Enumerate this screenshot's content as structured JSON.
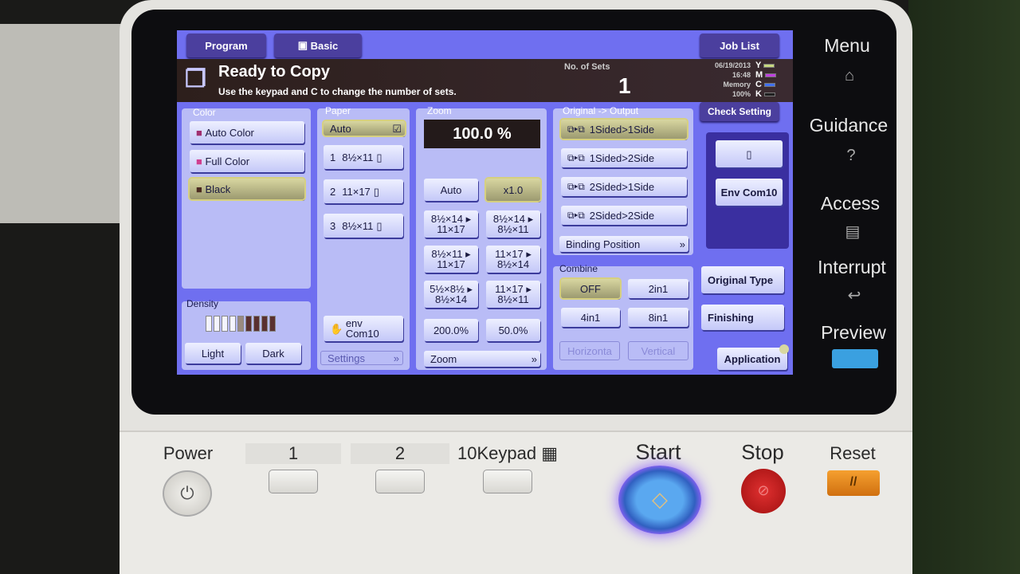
{
  "tabs": {
    "program": "Program",
    "basic": "Basic",
    "job_list": "Job List",
    "check_setting": "Check Setting"
  },
  "status": {
    "title": "Ready to Copy",
    "message": "Use the keypad and C to change the number of sets.",
    "sets_label": "No. of Sets",
    "sets_value": "1",
    "date": "06/19/2013",
    "time": "16:48",
    "memory_label": "Memory",
    "memory_value": "100%",
    "toners": [
      {
        "letter": "Y",
        "color": "#c8d880"
      },
      {
        "letter": "M",
        "color": "#c040e0"
      },
      {
        "letter": "C",
        "color": "#4070f0"
      },
      {
        "letter": "K",
        "color": "#202020"
      }
    ]
  },
  "color": {
    "label": "Color",
    "items": [
      "Auto Color",
      "Full Color",
      "Black"
    ],
    "selected": "Black"
  },
  "density": {
    "label": "Density",
    "light": "Light",
    "dark": "Dark",
    "level": 5,
    "steps": 9
  },
  "paper": {
    "label": "Paper",
    "auto": "Auto",
    "trays": [
      {
        "num": "1",
        "size": "8½×11"
      },
      {
        "num": "2",
        "size": "11×17"
      },
      {
        "num": "3",
        "size": "8½×11"
      }
    ],
    "bypass_line1": "env",
    "bypass_line2": "Com10",
    "settings": "Settings"
  },
  "zoom": {
    "label": "Zoom",
    "value": "100.0 %",
    "auto": "Auto",
    "x1": "x1.0",
    "presets": [
      [
        "8½×14 ▸",
        "11×17"
      ],
      [
        "8½×14 ▸",
        "8½×11"
      ],
      [
        "8½×11 ▸",
        "11×17"
      ],
      [
        "11×17 ▸",
        "8½×14"
      ],
      [
        "5½×8½ ▸",
        "8½×14"
      ],
      [
        "11×17 ▸",
        "8½×11"
      ]
    ],
    "p200": "200.0%",
    "p50": "50.0%",
    "zoom_btn": "Zoom"
  },
  "original_output": {
    "label": "Original -> Output",
    "items": [
      "1Sided>1Side",
      "1Sided>2Side",
      "2Sided>1Side",
      "2Sided>2Side"
    ],
    "binding": "Binding Position"
  },
  "combine": {
    "label": "Combine",
    "off": "OFF",
    "in2": "2in1",
    "in4": "4in1",
    "in8": "8in1",
    "horizontal": "Horizonta",
    "vertical": "Vertical"
  },
  "side": {
    "env": "Env Com10",
    "original_type": "Original Type",
    "finishing": "Finishing",
    "application": "Application"
  },
  "hardkeys": {
    "menu": "Menu",
    "guidance": "Guidance",
    "access": "Access",
    "interrupt": "Interrupt",
    "preview": "Preview"
  },
  "bottom": {
    "power": "Power",
    "one": "1",
    "two": "2",
    "keypad": "10Keypad",
    "start": "Start",
    "stop": "Stop",
    "reset": "Reset"
  }
}
